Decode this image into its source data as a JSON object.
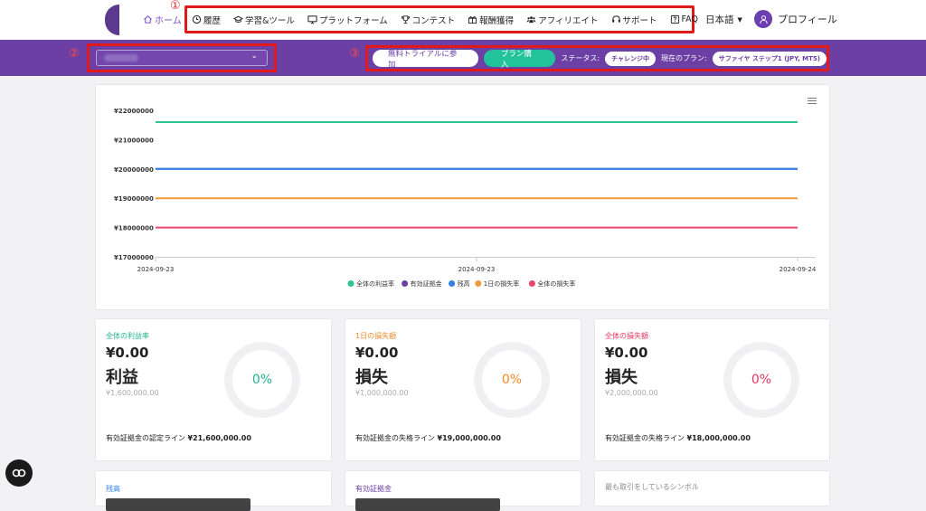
{
  "nav": {
    "home": "ホーム",
    "annotation": "①",
    "items": [
      {
        "label": "履歴",
        "icon": "clock-icon"
      },
      {
        "label": "学習&ツール",
        "icon": "graduation-cap-icon"
      },
      {
        "label": "プラットフォーム",
        "icon": "monitor-icon"
      },
      {
        "label": "コンテスト",
        "icon": "trophy-icon"
      },
      {
        "label": "報酬獲得",
        "icon": "gift-icon"
      },
      {
        "label": "アフィリエイト",
        "icon": "users-icon"
      },
      {
        "label": "サポート",
        "icon": "headset-icon"
      },
      {
        "label": "FAQ",
        "icon": "question-icon"
      }
    ],
    "language": "日本語",
    "profile": "プロフィール"
  },
  "band": {
    "annotation2": "②",
    "annotation3": "③",
    "trial_button": "無料トライアルに参加",
    "buy_button": "プラン購入",
    "status_label": "ステータス:",
    "status_value": "チャレンジ中",
    "plan_label": "現在のプラン:",
    "plan_value": "サファイヤ ステップ1 (JPY, MT5)"
  },
  "chart_data": {
    "type": "line",
    "x": [
      "2024-09-23",
      "2024-09-23",
      "2024-09-24"
    ],
    "ylim": [
      17000000,
      22000000
    ],
    "yticks": [
      "¥17000000",
      "¥18000000",
      "¥19000000",
      "¥20000000",
      "¥21000000",
      "¥22000000"
    ],
    "series": [
      {
        "name": "全体の利益率",
        "color": "#2ec48f",
        "values": [
          21600000,
          21600000,
          21600000
        ]
      },
      {
        "name": "有効証拠金",
        "color": "#6b3fa3",
        "values": [
          20000000,
          20000000,
          20000000
        ]
      },
      {
        "name": "残高",
        "color": "#2f7fe6",
        "values": [
          20000000,
          20000000,
          20000000
        ]
      },
      {
        "name": "1日の損失率",
        "color": "#f2993a",
        "values": [
          19000000,
          19000000,
          19000000
        ]
      },
      {
        "name": "全体の損失率",
        "color": "#e9476e",
        "values": [
          18000000,
          18000000,
          18000000
        ]
      }
    ]
  },
  "stats": [
    {
      "title": "全体の利益率",
      "color": "#22b58a",
      "value": "¥0.00",
      "word": "利益",
      "sub": "¥1,600,000.00",
      "percent": "0%",
      "foot_label": "有効証拠金の認定ライン",
      "foot_value": "¥21,600,000.00"
    },
    {
      "title": "1日の損失額",
      "color": "#f08a2a",
      "value": "¥0.00",
      "word": "損失",
      "sub": "¥1,000,000.00",
      "percent": "0%",
      "foot_label": "有効証拠金の失格ライン",
      "foot_value": "¥19,000,000.00"
    },
    {
      "title": "全体の損失額",
      "color": "#e8345f",
      "value": "¥0.00",
      "word": "損失",
      "sub": "¥2,000,000.00",
      "percent": "0%",
      "foot_label": "有効証拠金の失格ライン",
      "foot_value": "¥18,000,000.00"
    }
  ],
  "bottom_cards": [
    {
      "title": "残高",
      "color": "#2f7fe6"
    },
    {
      "title": "有効証拠金",
      "color": "#6b3fa3"
    },
    {
      "title": "最も取引をしているシンボル",
      "color": "#888888"
    }
  ]
}
